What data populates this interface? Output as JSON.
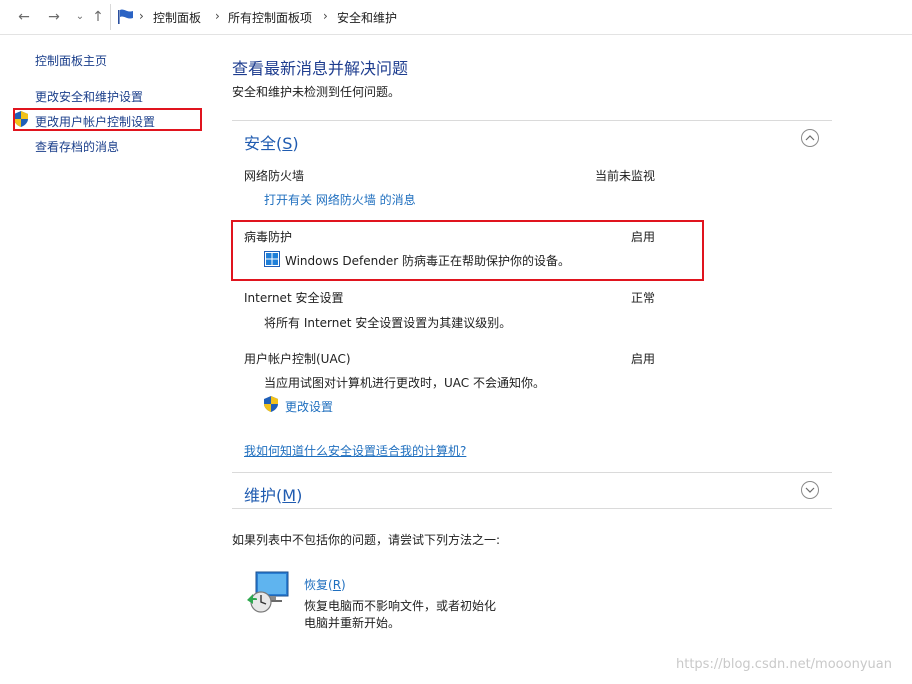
{
  "addressbar": {
    "crumbs": [
      "控制面板",
      "所有控制面板项",
      "安全和维护"
    ]
  },
  "sidebar": {
    "items": [
      {
        "label": "控制面板主页"
      },
      {
        "label": "更改安全和维护设置"
      },
      {
        "label": "更改用户帐户控制设置"
      },
      {
        "label": "查看存档的消息"
      }
    ]
  },
  "main": {
    "title": "查看最新消息并解决问题",
    "subtitle": "安全和维护未检测到任何问题。",
    "security": {
      "title": "安全",
      "accel": "S",
      "items": [
        {
          "label": "网络防火墙",
          "status": "当前未监视",
          "link": "打开有关 网络防火墙 的消息"
        },
        {
          "label": "病毒防护",
          "status": "启用",
          "desc": "Windows Defender 防病毒正在帮助保护你的设备。"
        },
        {
          "label": "Internet 安全设置",
          "status": "正常",
          "desc": "将所有 Internet 安全设置设置为其建议级别。"
        },
        {
          "label": "用户帐户控制(UAC)",
          "status": "启用",
          "desc": "当应用试图对计算机进行更改时，UAC 不会通知你。",
          "link": "更改设置"
        }
      ],
      "help_link": "我如何知道什么安全设置适合我的计算机?"
    },
    "maintenance": {
      "title": "维护",
      "accel": "M"
    },
    "intro": "如果列表中不包括你的问题，请尝试下列方法之一:",
    "recovery": {
      "label": "恢复",
      "accel": "R",
      "desc": "恢复电脑而不影响文件，或者初始化电脑并重新开始。"
    }
  },
  "watermark": "https://blog.csdn.net/mooonyuan",
  "colors": {
    "highlight_border": "#e0141e",
    "link": "#1f6fbf",
    "heading": "#1e3d8f"
  }
}
